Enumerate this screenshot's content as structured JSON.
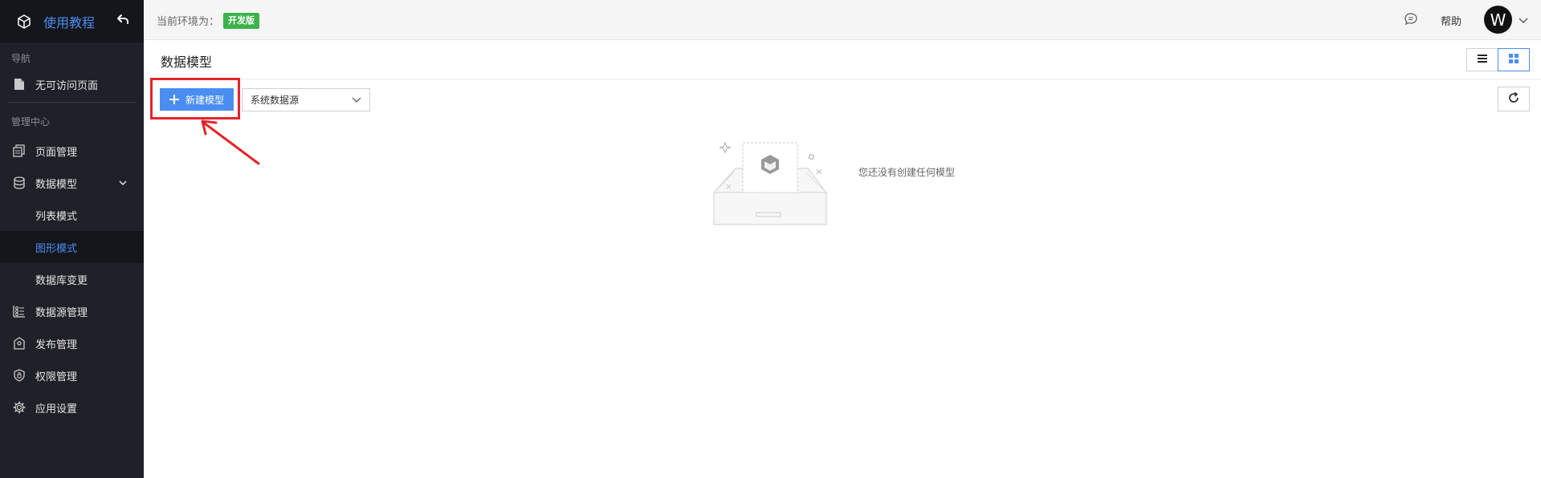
{
  "sidebar": {
    "app_name": "使用教程",
    "sections": {
      "nav": "导航",
      "admin": "管理中心"
    },
    "items": {
      "no_access": "无可访问页面",
      "page_mgmt": "页面管理",
      "data_model": "数据模型",
      "list_mode": "列表模式",
      "graph_mode": "图形模式",
      "db_change": "数据库变更",
      "datasource_mgmt": "数据源管理",
      "publish_mgmt": "发布管理",
      "permission_mgmt": "权限管理",
      "app_settings": "应用设置"
    }
  },
  "topbar": {
    "env_label": "当前环境为：",
    "env_badge": "开发版",
    "help": "帮助",
    "avatar_letter": "W"
  },
  "main": {
    "title": "数据模型",
    "new_button": "新建模型",
    "datasource_select": "系统数据源",
    "empty_text": "您还没有创建任何模型"
  },
  "colors": {
    "accent": "#4a8df0",
    "sidebar_bg": "#1f2028",
    "badge_green": "#3bb34a",
    "annotation_red": "#e3242b"
  },
  "icons": {
    "logo": "cube-icon",
    "back": "undo-arrow-icon",
    "chat": "chat-bubble-icon",
    "list_view": "list-view-icon",
    "grid_view": "grid-view-icon",
    "refresh": "refresh-icon"
  }
}
